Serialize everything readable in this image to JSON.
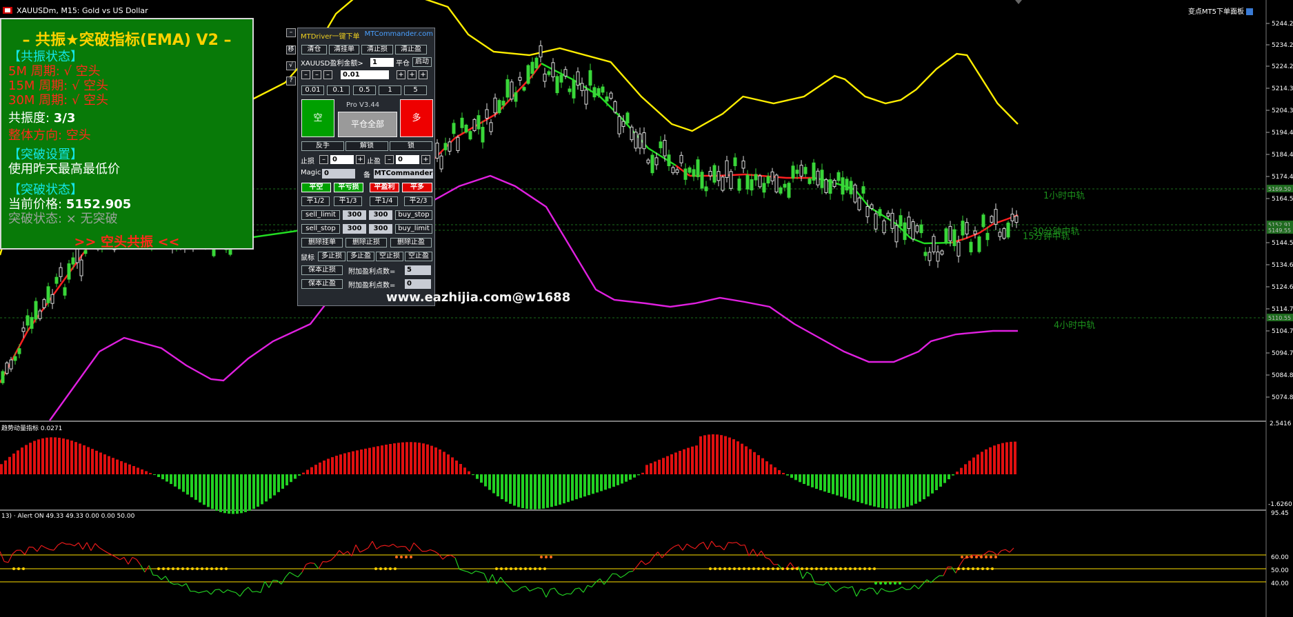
{
  "window": {
    "title": "XAUUSDm, M15:  Gold vs US Dollar",
    "top_right": "变点MT5下单面板"
  },
  "price_axis": {
    "labels": [
      "5244.22",
      "5234.25",
      "5224.29",
      "5214.33",
      "5204.36",
      "5194.40",
      "5184.43",
      "5174.48",
      "5164.52",
      "5144.59",
      "5134.63",
      "5124.66",
      "5114.70",
      "5104.74",
      "5094.77",
      "5084.80",
      "5074.84"
    ],
    "tags": [
      "5169.50",
      "5152.91",
      "5149.55",
      "5110.55"
    ]
  },
  "indicator_panel": {
    "title": "– 共振★突破指标(EMA) V2 –",
    "resonance_header": "【共振状态】",
    "m5": "5M 周期: √ 空头",
    "m15": "15M 周期: √ 空头",
    "m30": "30M 周期: √ 空头",
    "degree_label": "共振度: ",
    "degree_value": "3/3",
    "direction": "整体方向: 空头",
    "breakout_header": "【突破设置】",
    "breakout_setting": "使用昨天最高最低价",
    "breakout_status_header": "【突破状态】",
    "price_label": "当前价格: ",
    "price_value": "5152.905",
    "breakout_status": "突破状态: × 无突破",
    "footer": ">> 空头共振 <<"
  },
  "side_buttons": [
    "–",
    "移",
    "√",
    "?"
  ],
  "mt_panel": {
    "header_left": "MTDriver一键下单",
    "header_right": "MTCommander.com",
    "row1": [
      "清仓",
      "清挂单",
      "清止损",
      "清止盈"
    ],
    "pnl_label": "XAUUSD盈利金额>",
    "pnl_value": "1",
    "close_label": "平仓",
    "start_label": "启动",
    "lot_value": "0.01",
    "minus": "–",
    "plus": "+",
    "lots": [
      "0.01",
      "0.1",
      "0.5",
      "1",
      "5"
    ],
    "version": "Pro V3.44",
    "sell": "空",
    "buy": "多",
    "close_all": "平仓全部",
    "row_reverse": [
      "反手",
      "解锁",
      "锁"
    ],
    "sl_label": "止损",
    "sl_value": "0",
    "tp_label": "止盈",
    "tp_value": "0",
    "magic_label": "Magic",
    "magic_value": "0",
    "note_label": "备",
    "note_value": "MTCommander",
    "close_row": [
      "平空",
      "平亏损",
      "平盈利",
      "平多"
    ],
    "partial_row": [
      "平1/2",
      "平1/3",
      "平1/4",
      "平2/3"
    ],
    "sell_limit": "sell_limit",
    "buy_stop": "buy_stop",
    "sell_stop": "sell_stop",
    "buy_limit": "buy_limit",
    "pending_value": "300",
    "delete_row": [
      "删除挂单",
      "删除止损",
      "删除止盈"
    ],
    "mouse_label": "鼠标",
    "mouse_row": [
      "多止损",
      "多止盈",
      "空止损",
      "空止盈"
    ],
    "be_sl": "保本止损",
    "be_tp": "保本止盈",
    "extra_label": "附加盈利点数=",
    "extra_sl": "5",
    "extra_tp": "0"
  },
  "watermark": "www.eazhijia.com@w1688",
  "chart_labels": {
    "h1": "1小时中轨",
    "m30": "30分钟中轨",
    "m15": "15分钟中轨",
    "h4": "4小时中轨"
  },
  "subwindow1": {
    "title": "趋势动量指标 0.0271",
    "max": "2.5416",
    "min": "-1.6260"
  },
  "subwindow2": {
    "title": "13) · Alert ON 49.33 49.33 0.00 0.00 50.00",
    "levels": [
      "95.45",
      "60.00",
      "50.00",
      "40.00"
    ]
  }
}
